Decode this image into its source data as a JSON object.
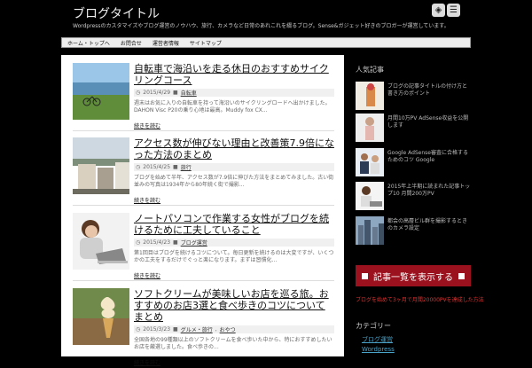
{
  "header": {
    "site_title": "ブログタイトル",
    "description": "Wordpressのカスタマイズやブログ運営のノウハウ、旅行、カメラなど日常のあれこれを綴るブログ。Sense&ガジェット好きのブロガーが運営しています。"
  },
  "top_icons": {
    "feedly": "feedly",
    "rss": "RSS"
  },
  "nav": {
    "items": [
      "ホーム・トップへ",
      "お問合せ",
      "運営者情報",
      "サイトマップ"
    ]
  },
  "posts": [
    {
      "title": "自転車で海沿いを走る休日のおすすめサイクリングコース",
      "date": "2015/4/29",
      "category": "自転車",
      "excerpt": "週末はお気に入りの自転車を持って海沿いのサイクリングロードへ出かけました。DAHON Visc P20の乗り心地は最高。Muddy fox CX...",
      "readmore": "続きを読む"
    },
    {
      "title": "アクセス数が伸びない理由と改善策7.9倍になった方法のまとめ",
      "date": "2015/4/25",
      "category": "旅行",
      "excerpt": "ブログを始めて半年、アクセス数が7.9倍に伸びた方法をまとめてみました。古い街並みの写真は1934年から80年続く街で撮影...",
      "readmore": "続きを読む"
    },
    {
      "title": "ノートパソコンで作業する女性がブログを続けるために工夫していること",
      "date": "2015/4/23",
      "category": "ブログ運営",
      "excerpt": "第1回目はブログを続けるコツについて。毎日更新を続けるのは大変ですが、いくつかの工夫をするだけでぐっと楽になります。まずは習慣化...",
      "readmore": "続きを読む"
    },
    {
      "title": "ソフトクリームが美味しいお店を巡る旅。おすすめのお店3選と食べ歩きのコツについてまとめ",
      "date": "2015/3/23",
      "categories": [
        "グルメ・旅行",
        "おやつ"
      ],
      "excerpt": "全国各地の99種類以上のソフトクリームを食べ歩いた中から、特におすすめしたいお店を厳選しました。食べ歩きの...",
      "readmore": "続きを読む"
    }
  ],
  "sidebar": {
    "popular_heading": "人気記事",
    "popular": [
      "ブログの記事タイトルの付け方と書き方のポイント",
      "月間10万PV AdSense収益を公開します",
      "Google AdSense審査に合格するためのコツ Google",
      "2015年上半期に読まれた記事トップ10 月間200万PV",
      "都会の高層ビル群を撮影するときのカメラ設定"
    ],
    "button_label": "記事一覧を表示する",
    "link_text": "ブログを始めて3ヶ月で月間20000PVを達成した方法",
    "category_heading": "カテゴリー",
    "categories": [
      "ブログ運営",
      "Wordpress"
    ]
  }
}
